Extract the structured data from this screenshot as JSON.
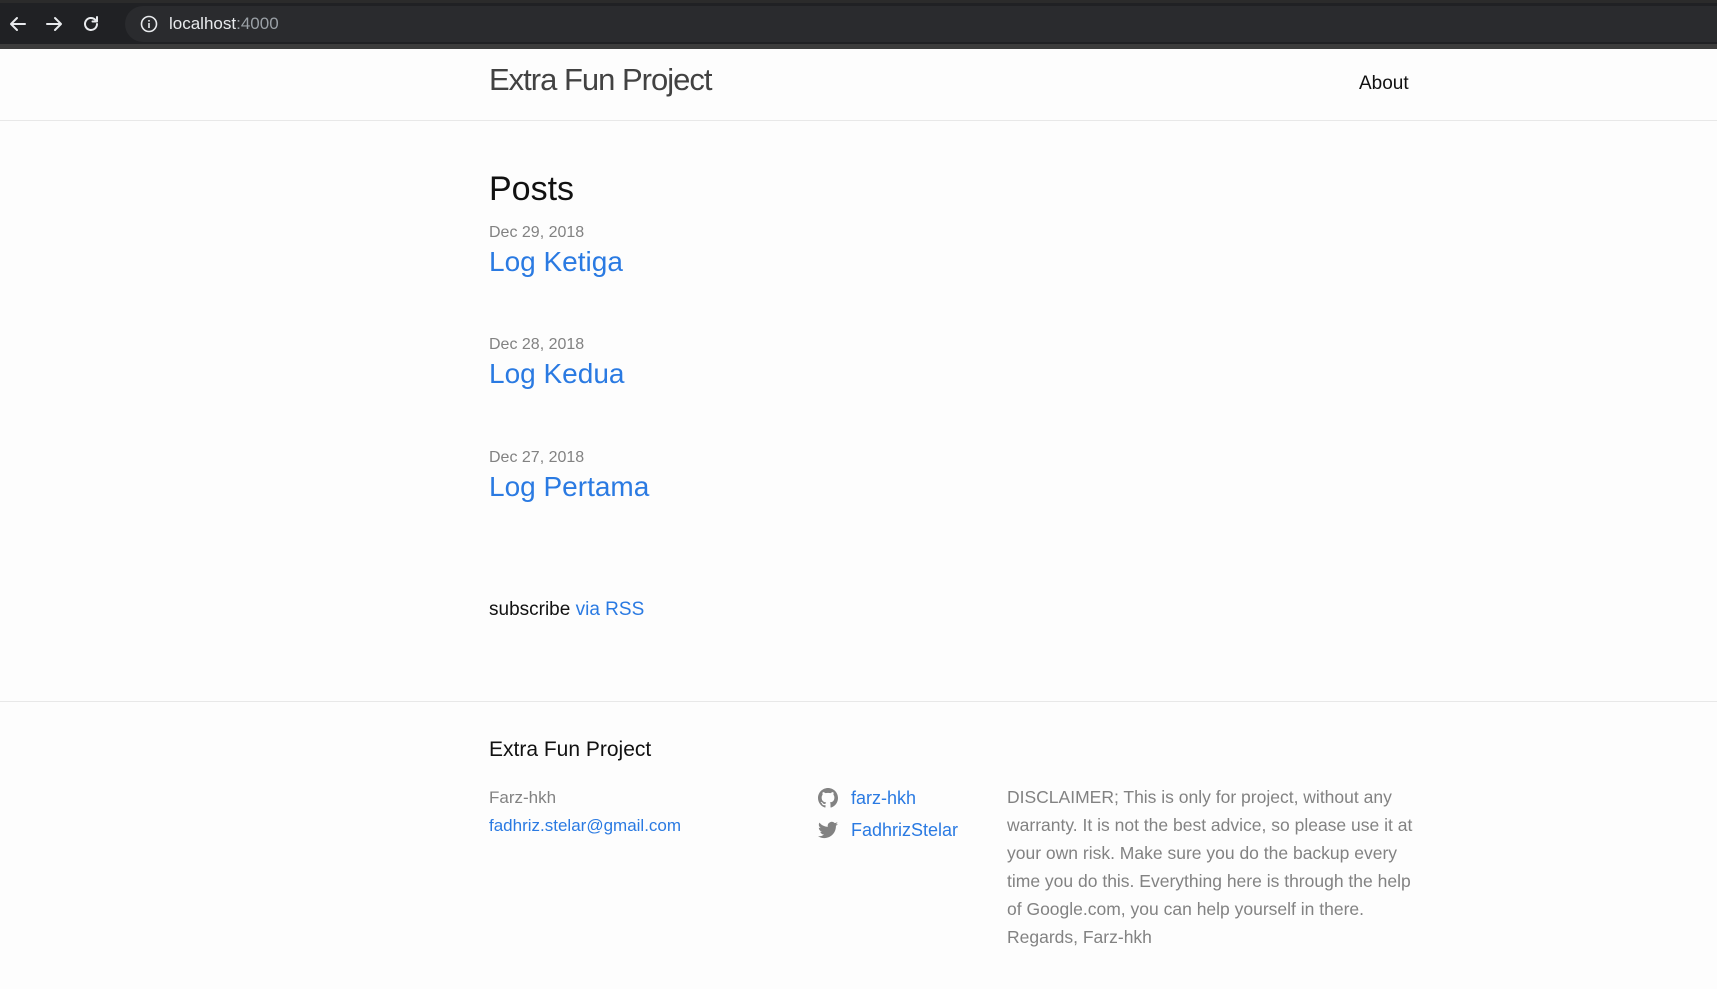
{
  "browser": {
    "url_host": "localhost",
    "url_port": ":4000"
  },
  "header": {
    "site_title": "Extra Fun Project",
    "nav_about": "About"
  },
  "main": {
    "heading": "Posts",
    "posts": [
      {
        "date": "Dec 29, 2018",
        "title": "Log Ketiga"
      },
      {
        "date": "Dec 28, 2018",
        "title": "Log Kedua"
      },
      {
        "date": "Dec 27, 2018",
        "title": "Log Pertama"
      }
    ],
    "subscribe_text": "subscribe",
    "rss_link": "via RSS"
  },
  "footer": {
    "heading": "Extra Fun Project",
    "author": "Farz-hkh",
    "email": "fadhriz.stelar@gmail.com",
    "github_user": "farz-hkh",
    "twitter_user": "FadhrizStelar",
    "disclaimer": "DISCLAIMER; This is only for project, without any warranty. It is not the best advice, so please use it at your own risk. Make sure you do the backup every time you do this. Everything here is through the help of Google.com, you can help yourself in there. Regards, Farz-hkh"
  },
  "colors": {
    "link": "#2a7ae2",
    "meta": "#828282",
    "chrome_bg": "#202124"
  },
  "icons": [
    "back-arrow-icon",
    "forward-arrow-icon",
    "reload-icon",
    "info-icon",
    "github-icon",
    "twitter-icon"
  ]
}
